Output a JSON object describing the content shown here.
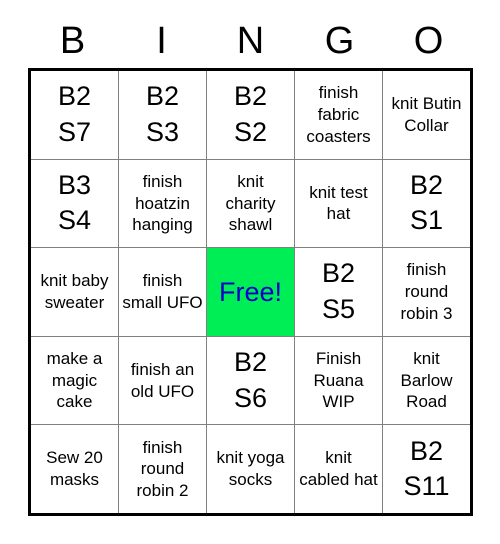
{
  "card": {
    "header": {
      "letters": [
        "B",
        "I",
        "N",
        "G",
        "O"
      ]
    },
    "colors": {
      "free_space_background": "#00ee55",
      "free_space_text": "#0000cc",
      "grid_line": "#808080",
      "grid_border": "#000000",
      "cell_background": "#ffffff",
      "text": "#000000"
    },
    "rows": [
      [
        {
          "text": "B2\nS7",
          "style": "number",
          "marked": false
        },
        {
          "text": "B2\nS3",
          "style": "number",
          "marked": false
        },
        {
          "text": "B2\nS2",
          "style": "number",
          "marked": false
        },
        {
          "text": "finish fabric coasters",
          "style": "task",
          "marked": false
        },
        {
          "text": "knit Butin Collar",
          "style": "task",
          "marked": false
        }
      ],
      [
        {
          "text": "B3\nS4",
          "style": "number",
          "marked": false
        },
        {
          "text": "finish hoatzin hanging",
          "style": "task",
          "marked": false
        },
        {
          "text": "knit charity shawl",
          "style": "task",
          "marked": false
        },
        {
          "text": "knit test hat",
          "style": "task",
          "marked": false
        },
        {
          "text": "B2\nS1",
          "style": "number",
          "marked": false
        }
      ],
      [
        {
          "text": "knit baby sweater",
          "style": "task",
          "marked": false
        },
        {
          "text": "finish small UFO",
          "style": "task",
          "marked": false
        },
        {
          "text": "Free!",
          "style": "free",
          "marked": true
        },
        {
          "text": "B2\nS5",
          "style": "number",
          "marked": false
        },
        {
          "text": "finish round robin 3",
          "style": "task",
          "marked": false
        }
      ],
      [
        {
          "text": "make a magic cake",
          "style": "task",
          "marked": false
        },
        {
          "text": "finish an old UFO",
          "style": "task",
          "marked": false
        },
        {
          "text": "B2\nS6",
          "style": "number",
          "marked": false
        },
        {
          "text": "Finish Ruana WIP",
          "style": "task",
          "marked": false
        },
        {
          "text": "knit Barlow Road",
          "style": "task",
          "marked": false
        }
      ],
      [
        {
          "text": "Sew 20 masks",
          "style": "task",
          "marked": false
        },
        {
          "text": "finish round robin 2",
          "style": "task",
          "marked": false
        },
        {
          "text": "knit yoga socks",
          "style": "task",
          "marked": false
        },
        {
          "text": "knit cabled hat",
          "style": "task",
          "marked": false
        },
        {
          "text": "B2\nS11",
          "style": "number",
          "marked": false
        }
      ]
    ]
  }
}
